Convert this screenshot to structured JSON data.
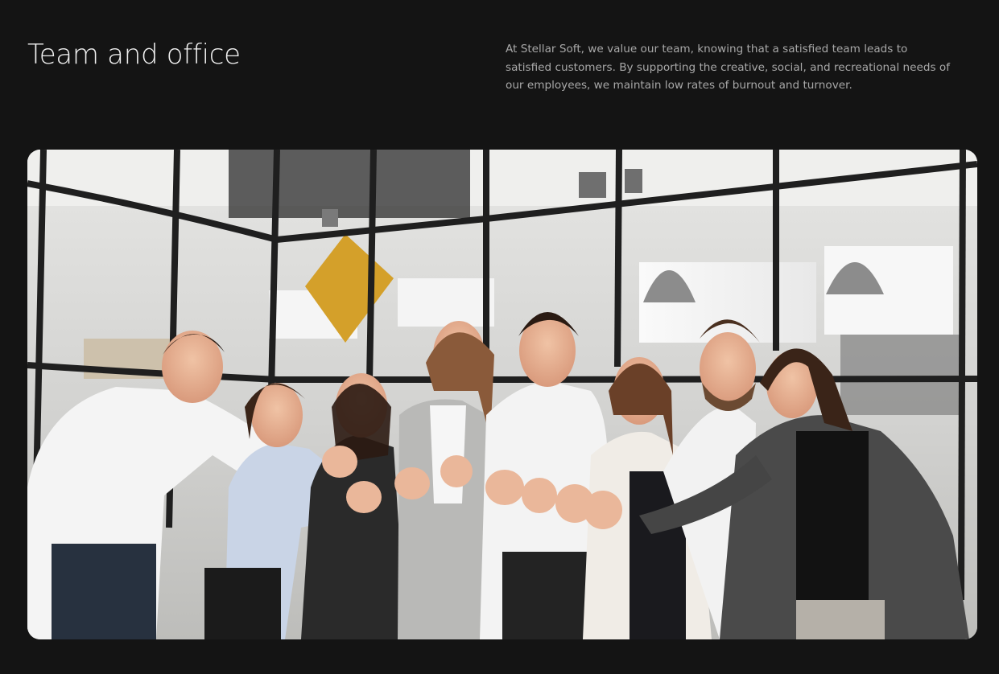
{
  "section": {
    "title": "Team and office",
    "description": "At Stellar Soft, we value our team, knowing that a satisfied team leads to satisfied customers. By supporting the creative, social, and recreational needs of our employees, we maintain low rates of burnout and turnover."
  },
  "colors": {
    "background": "#141414",
    "title": "#f0f0f0",
    "body_text": "#a8a8a8"
  }
}
